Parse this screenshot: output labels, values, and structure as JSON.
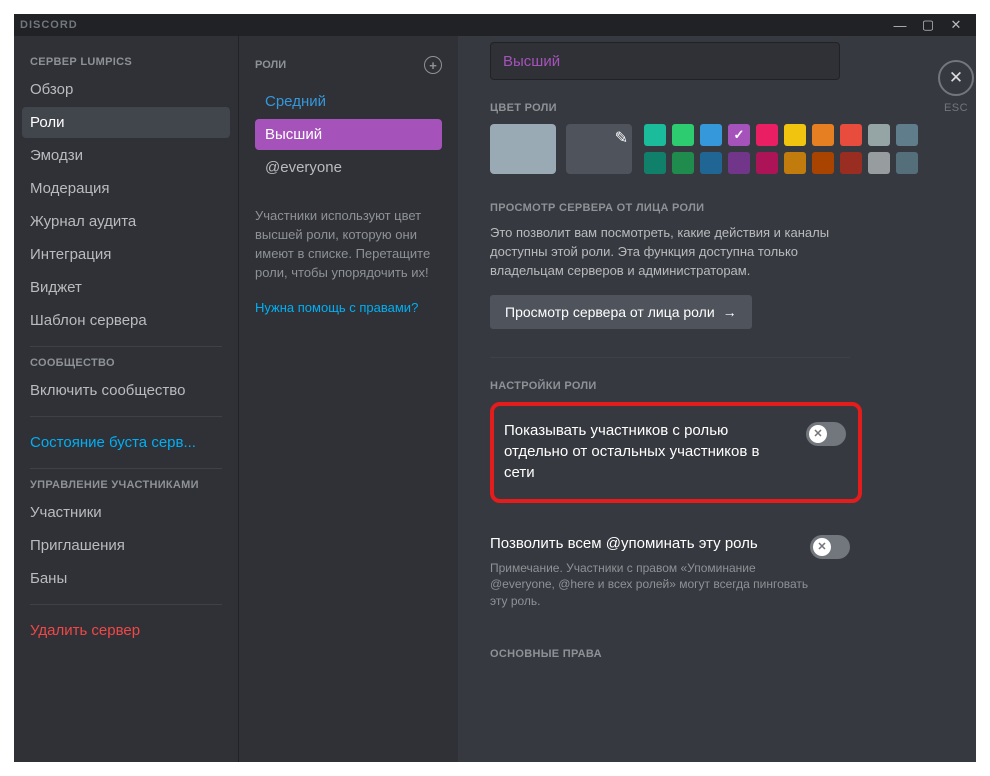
{
  "titlebar": {
    "brand": "DISCORD"
  },
  "esc": {
    "label": "ESC",
    "icon": "✕"
  },
  "sidebar": {
    "header1": "СЕРВЕР LUMPICS",
    "items1": [
      "Обзор",
      "Роли",
      "Эмодзи",
      "Модерация",
      "Журнал аудита",
      "Интеграция",
      "Виджет",
      "Шаблон сервера"
    ],
    "header2": "СООБЩЕСТВО",
    "items2": [
      "Включить сообщество"
    ],
    "boost": "Состояние буста серв...",
    "header3": "УПРАВЛЕНИЕ УЧАСТНИКАМИ",
    "items3": [
      "Участники",
      "Приглашения",
      "Баны"
    ],
    "delete": "Удалить сервер"
  },
  "roles": {
    "header": "РОЛИ",
    "list": [
      "Средний",
      "Высший",
      "@everyone"
    ],
    "help": "Участники используют цвет высшей роли, которую они имеют в списке. Перетащите роли, чтобы упорядочить их!",
    "helplink": "Нужна помощь с правами?"
  },
  "content": {
    "dropdown_value": "Высший",
    "color_label": "ЦВЕТ РОЛИ",
    "colors_row1": [
      "#1abc9c",
      "#2ecc71",
      "#3498db",
      "#a652bb",
      "#e91e63",
      "#f1c40f",
      "#e67e22",
      "#e74c3c",
      "#95a5a6",
      "#607d8b"
    ],
    "colors_row2": [
      "#11806a",
      "#1f8b4c",
      "#206694",
      "#71368a",
      "#ad1457",
      "#c27c0e",
      "#a84300",
      "#992d22",
      "#979c9f",
      "#546e7a"
    ],
    "color_checked_index": 3,
    "preview_label": "ПРОСМОТР СЕРВЕРА ОТ ЛИЦА РОЛИ",
    "preview_desc": "Это позволит вам посмотреть, какие действия и каналы доступны этой роли. Эта функция доступна только владельцам серверов и администраторам.",
    "preview_btn": "Просмотр сервера от лица роли",
    "role_settings_label": "НАСТРОЙКИ РОЛИ",
    "setting1_title": "Показывать участников с ролью отдельно от остальных участников в сети",
    "setting2_title": "Позволить всем @упоминать эту роль",
    "setting2_note": "Примечание. Участники с правом «Упоминание @everyone, @here и всех ролей» могут всегда пинговать эту роль.",
    "basic_rights_label": "ОСНОВНЫЕ ПРАВА"
  }
}
